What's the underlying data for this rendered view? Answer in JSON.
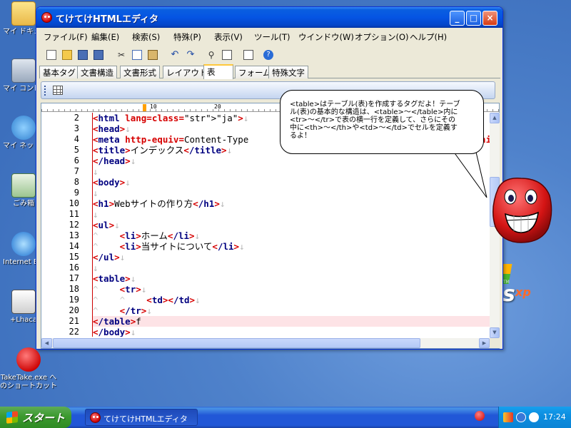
{
  "desktop": {
    "icons": [
      {
        "label": "マイ ドキュメント",
        "name": "my-documents"
      },
      {
        "label": "マイ コンピュータ",
        "name": "my-computer"
      },
      {
        "label": "マイ ネットワーク",
        "name": "my-network"
      },
      {
        "label": "ごみ箱",
        "name": "recycle-bin"
      },
      {
        "label": "Internet Explorer",
        "name": "internet-explorer"
      },
      {
        "label": "+Lhaca",
        "name": "lhaca"
      },
      {
        "label": "TakeTake.exe へのショートカット",
        "name": "taketake-shortcut"
      }
    ],
    "os_logo": {
      "text": "s",
      "sup": "xp",
      "tm": "TM"
    }
  },
  "window": {
    "title": "てけてけHTMLエディタ",
    "controls": {
      "minimize": "_",
      "maximize": "□",
      "close": "×"
    },
    "menu": [
      "ファイル(F)",
      "編集(E)",
      "検索(S)",
      "特殊(P)",
      "表示(V)",
      "ツール(T)",
      "ウインドウ(W)",
      "オプション(O)",
      "ヘルプ(H)"
    ],
    "toolbar_icons": [
      "new-file-icon",
      "open-folder-icon",
      "save-icon",
      "save-all-icon",
      "cut-icon",
      "copy-icon",
      "paste-icon",
      "undo-icon",
      "redo-icon",
      "search-icon",
      "replace-icon",
      "preview-icon",
      "help-icon"
    ],
    "tabs": [
      "基本タグ",
      "文書構造",
      "文書形式",
      "レイアウト",
      "表",
      "フォーム",
      "特殊文字"
    ],
    "active_tab": "表",
    "ruler": {
      "labels": [
        "10",
        "20",
        "60"
      ]
    }
  },
  "editor": {
    "lines": [
      {
        "num": "2",
        "code": "<html lang=\"ja\">↓"
      },
      {
        "num": "3",
        "code": "<head>↓"
      },
      {
        "num": "4",
        "code": "<meta http-equiv=Content-Type"
      },
      {
        "num": "5",
        "code": "<title>インデックス</title>↓"
      },
      {
        "num": "6",
        "code": "</head>↓"
      },
      {
        "num": "7",
        "code": "↓"
      },
      {
        "num": "8",
        "code": "<body>↓"
      },
      {
        "num": "9",
        "code": "↓"
      },
      {
        "num": "10",
        "code": "<h1>Webサイトの作り方</h1>↓"
      },
      {
        "num": "11",
        "code": "↓"
      },
      {
        "num": "12",
        "code": "<ul>↓"
      },
      {
        "num": "13",
        "code": "^    <li>ホーム</li>↓"
      },
      {
        "num": "14",
        "code": "^    <li>当サイトについて</li>↓"
      },
      {
        "num": "15",
        "code": "</ul>↓"
      },
      {
        "num": "16",
        "code": "↓"
      },
      {
        "num": "17",
        "code": "<table>↓"
      },
      {
        "num": "18",
        "code": "^    <tr>↓"
      },
      {
        "num": "19",
        "code": "^    ^    <td></td>↓"
      },
      {
        "num": "20",
        "code": "^    </tr>↓"
      },
      {
        "num": "21",
        "code": "</table>f"
      },
      {
        "num": "22",
        "code": "</body>↓"
      }
    ],
    "right_fragment": "=shi",
    "current_line": "21"
  },
  "balloon": {
    "text": "<table>はテーブル(表)を作成するタグだよ！テーブル(表)の基本的な構造は、<table>〜</table>内に<tr>〜</tr>で表の横一行を定義して、さらにその中に<th>〜</th>や<td>〜</td>でセルを定義するよ！"
  },
  "taskbar": {
    "start_label": "スタート",
    "task_title": "てけてけHTMLエディタ",
    "clock": "17:24"
  },
  "colors": {
    "titlebar": "#0554e3",
    "tag": "#000080",
    "bracket": "#d60000",
    "string": "#b000b0",
    "current_line": "#fde3e6",
    "start_button": "#3c9a2f"
  }
}
